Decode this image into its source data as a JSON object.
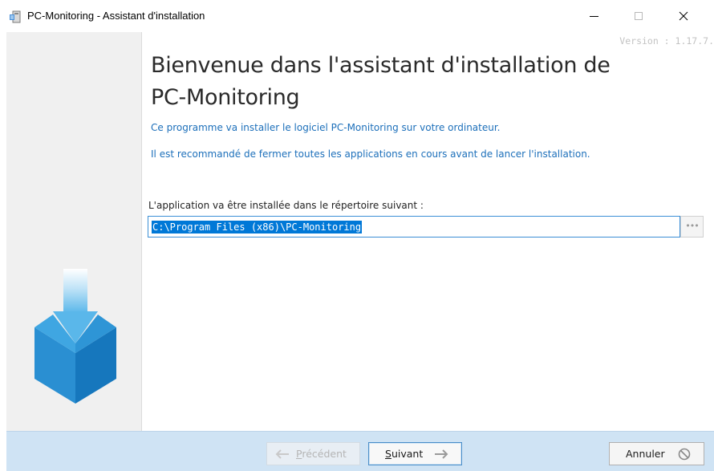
{
  "window": {
    "title": "PC-Monitoring - Assistant d'installation",
    "icon": "installer-app-icon"
  },
  "version": "Version : 1.17.7.",
  "heading": "Bienvenue dans l'assistant d'installation de PC-Monitoring",
  "info_line_1": "Ce programme va installer le logiciel PC-Monitoring sur votre ordinateur.",
  "info_line_2": "Il est recommandé de fermer toutes les applications en cours avant de lancer l'installation.",
  "directory": {
    "label": "L'application va être installée dans le répertoire suivant :",
    "value": "C:\\Program Files (x86)\\PC-Monitoring",
    "browse_label": "•••"
  },
  "buttons": {
    "previous": {
      "prefix": "",
      "accel": "P",
      "rest": "récédent",
      "enabled": false,
      "icon": "arrow-left-icon"
    },
    "next": {
      "accel": "S",
      "rest": "uivant",
      "enabled": true,
      "icon": "arrow-right-icon"
    },
    "cancel": {
      "label": "Annuler",
      "icon": "cancel-circle-icon"
    }
  },
  "colors": {
    "accent": "#1c6fba",
    "selection": "#0078d7",
    "footer": "#cfe3f4",
    "sidebar": "#f0f0f0"
  }
}
